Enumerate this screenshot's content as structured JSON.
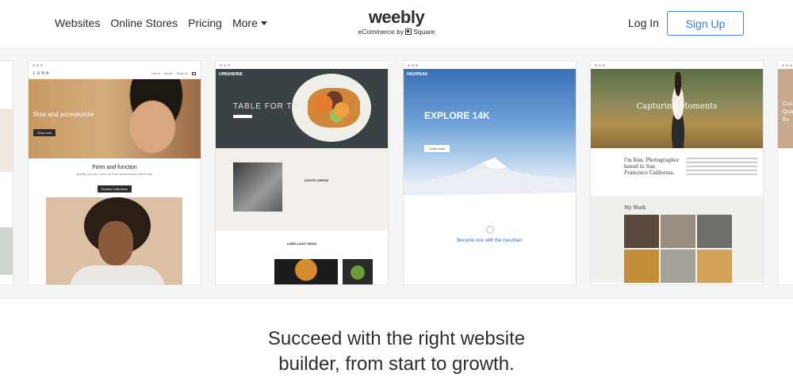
{
  "header": {
    "nav": [
      "Websites",
      "Online Stores",
      "Pricing",
      "More"
    ],
    "logo": {
      "word": "weebly",
      "sub_prefix": "eCommerce by",
      "sub_brand": "Square"
    },
    "login_label": "Log In",
    "signup_label": "Sign Up",
    "colors": {
      "accent": "#3b7bd4",
      "text": "#2d2d2d"
    }
  },
  "templates": {
    "luna": {
      "logo": "LUNA",
      "nav_links": [
        "Home",
        "About",
        "Shop All"
      ],
      "hero_text": "Rise and accessorize",
      "hero_button": "Shop now",
      "section_title": "Form and function",
      "section_body": "Quality you can count on from accessories built to last.",
      "section_button": "Browse collections"
    },
    "urbandine": {
      "logo": "URBANDINE",
      "hero_title": "TABLE FOR TWO",
      "name": "DONTE OWENS",
      "menu_title": "A BRILLIANT MENU"
    },
    "highpeak": {
      "logo": "HIGHPEAK",
      "hero_title": "EXPLORE 14K",
      "hero_button": "Learn more",
      "tagline": "Become one with the mountain"
    },
    "kim": {
      "hero_title": "Capturing Moments",
      "intro": "I'm Kim, Photographer based in San Francisco California.",
      "work_title": "My Work"
    },
    "right_partial": {
      "hero_text": "Cus Qua Ex"
    }
  },
  "headline": {
    "line1": "Succeed with the right website",
    "line2": "builder, from start to growth."
  }
}
